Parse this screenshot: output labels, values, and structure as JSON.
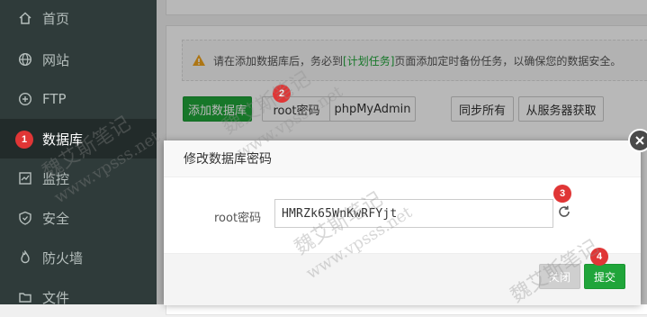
{
  "sidebar": {
    "items": [
      {
        "label": "首页",
        "icon": "home-icon"
      },
      {
        "label": "网站",
        "icon": "globe-icon"
      },
      {
        "label": "FTP",
        "icon": "ftp-icon"
      },
      {
        "label": "数据库",
        "icon": "database-icon",
        "active": true
      },
      {
        "label": "监控",
        "icon": "monitor-icon"
      },
      {
        "label": "安全",
        "icon": "shield-icon"
      },
      {
        "label": "防火墙",
        "icon": "firewall-icon"
      },
      {
        "label": "文件",
        "icon": "folder-icon"
      }
    ]
  },
  "alert": {
    "prefix": "请在添加数据库后，务必到",
    "link": "[计划任务]",
    "suffix": "页面添加定时备份任务，以确保您的数据安全。"
  },
  "toolbar": {
    "add_db": "添加数据库",
    "root_password": "root密码",
    "phpmyadmin": "phpMyAdmin",
    "sync_all": "同步所有",
    "fetch_from_server": "从服务器获取"
  },
  "dialog": {
    "title": "修改数据库密码",
    "field_label": "root密码",
    "field_value": "HMRZk65WnKwRFYjt",
    "close_label": "关闭",
    "submit_label": "提交"
  },
  "badges": {
    "b1": "1",
    "b2": "2",
    "b3": "3",
    "b4": "4"
  },
  "watermark": {
    "brand": "魏艾斯笔记",
    "url": "www.vpsss.net"
  },
  "colors": {
    "accent": "#20a53a",
    "sidebar_bg": "#2f3b3a",
    "badge": "#e03636",
    "link": "#20a53a"
  }
}
